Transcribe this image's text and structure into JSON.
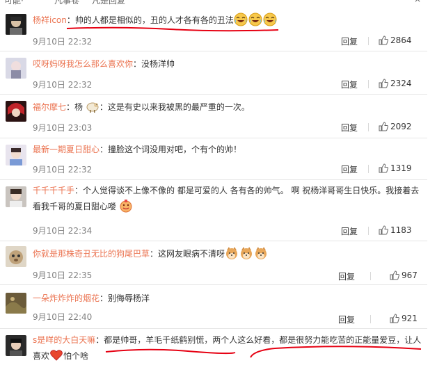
{
  "header": {
    "partial_1": "可能·",
    "partial_2": "凡事卷",
    "partial_3": "凡是回复",
    "close": "×"
  },
  "comments": [
    {
      "username": "杨祥icon",
      "text": "：帅的人都是相似的，丑的人才各有各的丑法",
      "date": "9月10日 22:32",
      "reply": "回复",
      "likes": "2864",
      "emojis": [
        "laugh-cry-emoji",
        "laugh-cry-emoji",
        "laugh-cry-emoji"
      ]
    },
    {
      "username": "哎呀妈呀我怎么那么喜欢你",
      "text": "：没杨洋帅",
      "date": "9月10日 22:32",
      "reply": "回复",
      "likes": "2324"
    },
    {
      "username": "福尔摩七",
      "text_pre": "：杨",
      "text": "：这是有史以来我被黑的最严重的一次。",
      "date": "9月10日 23:03",
      "reply": "回复",
      "likes": "2092"
    },
    {
      "username": "最新一期夏日甜心",
      "text": "：撞脸这个词没用对吧，个有个的帅！",
      "date": "9月10日 22:32",
      "reply": "回复",
      "likes": "1319"
    },
    {
      "username": "千千千千手",
      "text": "：个人觉得谈不上像不像的 都是可爱的人 各有各的帅气。 啊 祝杨洋哥哥生日快乐。我接着去看我千哥的夏日甜心喽",
      "date": "9月10日 22:34",
      "reply": "回复",
      "likes": "1183"
    },
    {
      "username": "你就是那株奇丑无比的狗尾巴草",
      "text": "：这网友眼病不清呀",
      "date": "9月10日 22:35",
      "reply": "回复",
      "likes": "967"
    },
    {
      "username": "一朵炸炸炸的烟花",
      "text": "：别侮辱杨洋",
      "date": "9月10日 22:40",
      "reply": "回复",
      "likes": "921"
    },
    {
      "username": "s是咩的大白天嘛",
      "text": "：都是帅哥，羊毛千纸鹤别慌，两个人这么好看，都是很努力能吃苦的正能量爱豆，让人喜欢",
      "text_post": "怕个啥"
    }
  ],
  "colors": {
    "username": "#eb7350",
    "annotation": "#e60012",
    "meta": "#808080"
  }
}
